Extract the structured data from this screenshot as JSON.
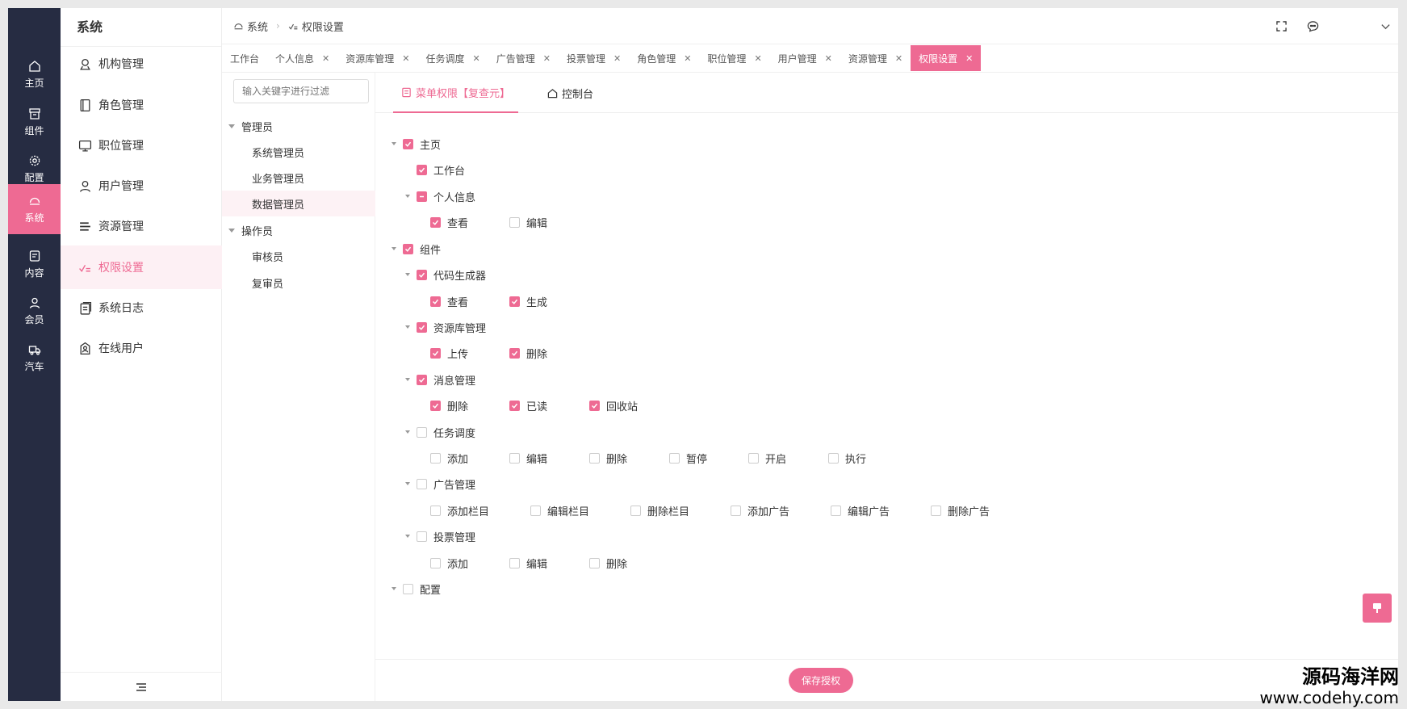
{
  "theme": {
    "accent": "#ee6a93",
    "rail_bg": "#262c42"
  },
  "rail": [
    {
      "label": "主页",
      "icon": "home-icon"
    },
    {
      "label": "组件",
      "icon": "box-icon"
    },
    {
      "label": "配置",
      "icon": "gear-icon"
    },
    {
      "label": "系统",
      "icon": "system-icon",
      "active": true
    },
    {
      "label": "内容",
      "icon": "content-icon"
    },
    {
      "label": "会员",
      "icon": "user-icon"
    },
    {
      "label": "汽车",
      "icon": "truck-icon"
    }
  ],
  "sidebar": {
    "title": "系统",
    "items": [
      {
        "label": "机构管理",
        "icon": "org-icon"
      },
      {
        "label": "角色管理",
        "icon": "book-icon"
      },
      {
        "label": "职位管理",
        "icon": "monitor-icon"
      },
      {
        "label": "用户管理",
        "icon": "user-icon"
      },
      {
        "label": "资源管理",
        "icon": "list-icon"
      },
      {
        "label": "权限设置",
        "icon": "permission-icon",
        "active": true
      },
      {
        "label": "系统日志",
        "icon": "log-icon"
      },
      {
        "label": "在线用户",
        "icon": "online-user-icon"
      }
    ]
  },
  "breadcrumb": {
    "first": "系统",
    "second": "权限设置"
  },
  "tabs": [
    {
      "label": "工作台",
      "closable": false
    },
    {
      "label": "个人信息",
      "closable": true
    },
    {
      "label": "资源库管理",
      "closable": true
    },
    {
      "label": "任务调度",
      "closable": true
    },
    {
      "label": "广告管理",
      "closable": true
    },
    {
      "label": "投票管理",
      "closable": true
    },
    {
      "label": "角色管理",
      "closable": true
    },
    {
      "label": "职位管理",
      "closable": true
    },
    {
      "label": "用户管理",
      "closable": true
    },
    {
      "label": "资源管理",
      "closable": true
    },
    {
      "label": "权限设置",
      "closable": true,
      "active": true
    }
  ],
  "roles": {
    "filter_placeholder": "输入关键字进行过滤",
    "groups": [
      {
        "label": "管理员",
        "children": [
          "系统管理员",
          "业务管理员",
          "数据管理员"
        ]
      },
      {
        "label": "操作员",
        "children": [
          "审核员",
          "复审员"
        ]
      }
    ],
    "active": "数据管理员"
  },
  "content_tabs": {
    "menu": "菜单权限【复查元】",
    "console": "控制台"
  },
  "permissions": {
    "home": {
      "label": "主页",
      "checked": true
    },
    "workbench": {
      "label": "工作台",
      "checked": true
    },
    "profile": {
      "label": "个人信息",
      "state": "indeterminate"
    },
    "profile_actions": [
      {
        "label": "查看",
        "checked": true
      },
      {
        "label": "编辑",
        "checked": false
      }
    ],
    "components": {
      "label": "组件",
      "checked": true
    },
    "codegen": {
      "label": "代码生成器",
      "checked": true
    },
    "codegen_actions": [
      {
        "label": "查看",
        "checked": true
      },
      {
        "label": "生成",
        "checked": true
      }
    ],
    "assets": {
      "label": "资源库管理",
      "checked": true
    },
    "assets_actions": [
      {
        "label": "上传",
        "checked": true
      },
      {
        "label": "删除",
        "checked": true
      }
    ],
    "messages": {
      "label": "消息管理",
      "checked": true
    },
    "messages_actions": [
      {
        "label": "删除",
        "checked": true
      },
      {
        "label": "已读",
        "checked": true
      },
      {
        "label": "回收站",
        "checked": true
      }
    ],
    "tasks": {
      "label": "任务调度",
      "checked": false
    },
    "tasks_actions": [
      {
        "label": "添加",
        "checked": false
      },
      {
        "label": "编辑",
        "checked": false
      },
      {
        "label": "删除",
        "checked": false
      },
      {
        "label": "暂停",
        "checked": false
      },
      {
        "label": "开启",
        "checked": false
      },
      {
        "label": "执行",
        "checked": false
      }
    ],
    "ads": {
      "label": "广告管理",
      "checked": false
    },
    "ads_actions": [
      {
        "label": "添加栏目",
        "checked": false
      },
      {
        "label": "编辑栏目",
        "checked": false
      },
      {
        "label": "删除栏目",
        "checked": false
      },
      {
        "label": "添加广告",
        "checked": false
      },
      {
        "label": "编辑广告",
        "checked": false
      },
      {
        "label": "删除广告",
        "checked": false
      }
    ],
    "votes": {
      "label": "投票管理",
      "checked": false
    },
    "votes_actions": [
      {
        "label": "添加",
        "checked": false
      },
      {
        "label": "编辑",
        "checked": false
      },
      {
        "label": "删除",
        "checked": false
      }
    ],
    "config": {
      "label": "配置",
      "checked": false
    }
  },
  "save_label": "保存授权",
  "watermark": {
    "line1": "源码海洋网",
    "line2": "www.codehy.com"
  }
}
